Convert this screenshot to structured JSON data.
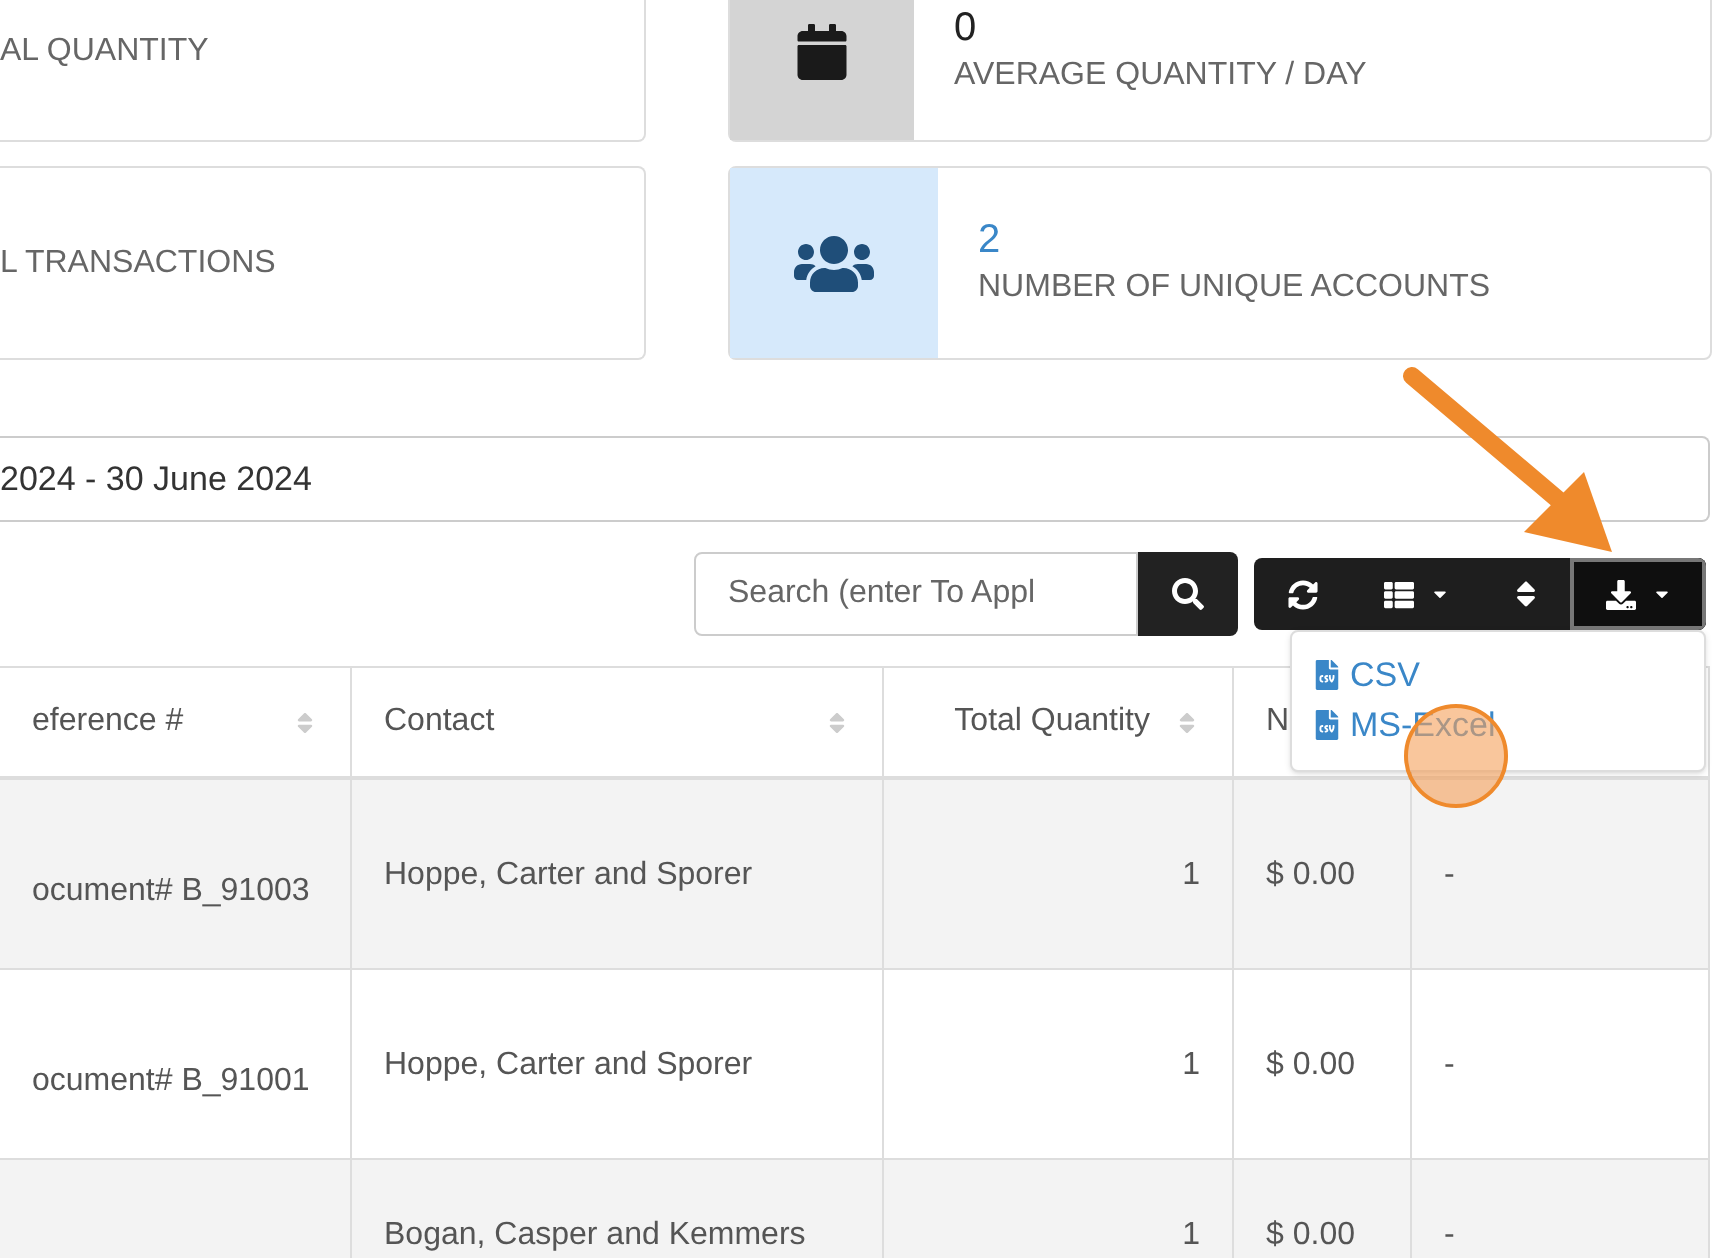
{
  "stat_cards": [
    {
      "label": "AL QUANTITY"
    },
    {
      "kind": "calendar",
      "value": "0",
      "label": "AVERAGE QUANTITY / DAY"
    },
    {
      "label": "L TRANSACTIONS"
    },
    {
      "kind": "users",
      "value": "2",
      "label": "NUMBER OF UNIQUE ACCOUNTS"
    }
  ],
  "date_range": "2024 - 30 June 2024",
  "search": {
    "placeholder": "Search (enter To Appl"
  },
  "toolbar": [
    {
      "kind": "refresh",
      "selected": false
    },
    {
      "kind": "columns",
      "selected": false
    },
    {
      "kind": "sort",
      "selected": false
    },
    {
      "kind": "export",
      "selected": true
    }
  ],
  "export_menu": [
    "CSV",
    "MS-Excel"
  ],
  "table": {
    "columns": [
      "eference #",
      "Contact",
      "Total Quantity",
      "N"
    ],
    "rows": [
      [
        "ocument# B_91003",
        "Hoppe, Carter and Sporer",
        "1",
        "$ 0.00",
        "-"
      ],
      [
        "ocument# B_91001",
        "Hoppe, Carter and Sporer",
        "1",
        "$ 0.00",
        "-"
      ],
      [
        "",
        "Bogan, Casper and Kemmers",
        "1",
        "$ 0.00",
        "-"
      ]
    ]
  }
}
